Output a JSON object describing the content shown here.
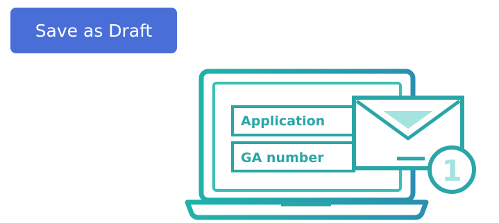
{
  "toolbar": {
    "save_draft_label": "Save as Draft"
  },
  "illustration": {
    "field_application_label": "Application",
    "field_ga_number_label": "GA number",
    "notification_count": "1"
  },
  "colors": {
    "button_bg": "#4a6ed8",
    "button_text": "#ffffff",
    "teal_primary": "#2aa6a7",
    "teal_light": "#5ed0c8",
    "teal_pale": "#a5e3df"
  }
}
